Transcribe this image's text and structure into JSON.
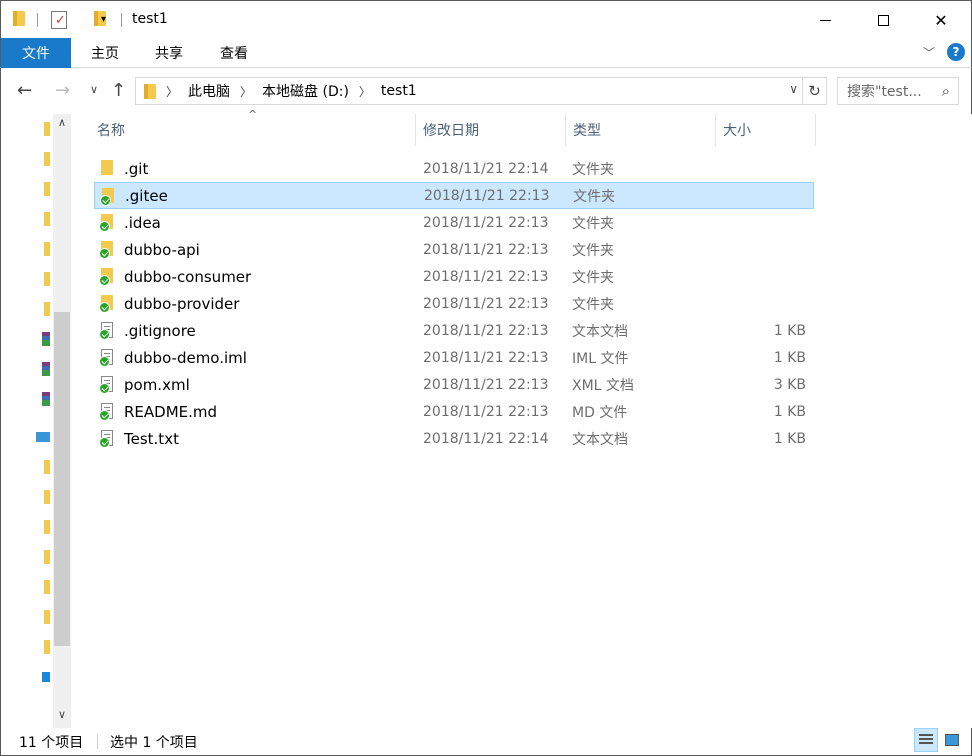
{
  "window": {
    "title": "test1"
  },
  "ribbon": {
    "tabs": [
      "文件",
      "主页",
      "共享",
      "查看"
    ]
  },
  "address": {
    "crumbs": [
      "此电脑",
      "本地磁盘 (D:)",
      "test1"
    ],
    "search_placeholder": "搜索\"test..."
  },
  "columns": {
    "name": "名称",
    "date": "修改日期",
    "type": "类型",
    "size": "大小"
  },
  "files": [
    {
      "name": ".git",
      "date": "2018/11/21 22:14",
      "type": "文件夹",
      "size": "",
      "icon": "folder-icon",
      "synced": false
    },
    {
      "name": ".gitee",
      "date": "2018/11/21 22:13",
      "type": "文件夹",
      "size": "",
      "icon": "folder-icon",
      "synced": true
    },
    {
      "name": ".idea",
      "date": "2018/11/21 22:13",
      "type": "文件夹",
      "size": "",
      "icon": "folder-icon",
      "synced": true
    },
    {
      "name": "dubbo-api",
      "date": "2018/11/21 22:13",
      "type": "文件夹",
      "size": "",
      "icon": "folder-icon",
      "synced": true
    },
    {
      "name": "dubbo-consumer",
      "date": "2018/11/21 22:13",
      "type": "文件夹",
      "size": "",
      "icon": "folder-icon",
      "synced": true
    },
    {
      "name": "dubbo-provider",
      "date": "2018/11/21 22:13",
      "type": "文件夹",
      "size": "",
      "icon": "folder-icon",
      "synced": true
    },
    {
      "name": ".gitignore",
      "date": "2018/11/21 22:13",
      "type": "文本文档",
      "size": "1 KB",
      "icon": "text-file-icon",
      "synced": true
    },
    {
      "name": "dubbo-demo.iml",
      "date": "2018/11/21 22:13",
      "type": "IML 文件",
      "size": "1 KB",
      "icon": "file-icon",
      "synced": true
    },
    {
      "name": "pom.xml",
      "date": "2018/11/21 22:13",
      "type": "XML 文档",
      "size": "3 KB",
      "icon": "xml-file-icon",
      "synced": true
    },
    {
      "name": "README.md",
      "date": "2018/11/21 22:13",
      "type": "MD 文件",
      "size": "1 KB",
      "icon": "file-icon",
      "synced": true
    },
    {
      "name": "Test.txt",
      "date": "2018/11/21 22:14",
      "type": "文本文档",
      "size": "1 KB",
      "icon": "text-file-icon",
      "synced": true
    }
  ],
  "selected_index": 1,
  "status": {
    "count": "11 个项目",
    "selection": "选中 1 个项目"
  },
  "colors": {
    "accent": "#1979ca",
    "selection": "#cce8ff",
    "folder": "#f3c94e",
    "sync_ok": "#28a428"
  }
}
